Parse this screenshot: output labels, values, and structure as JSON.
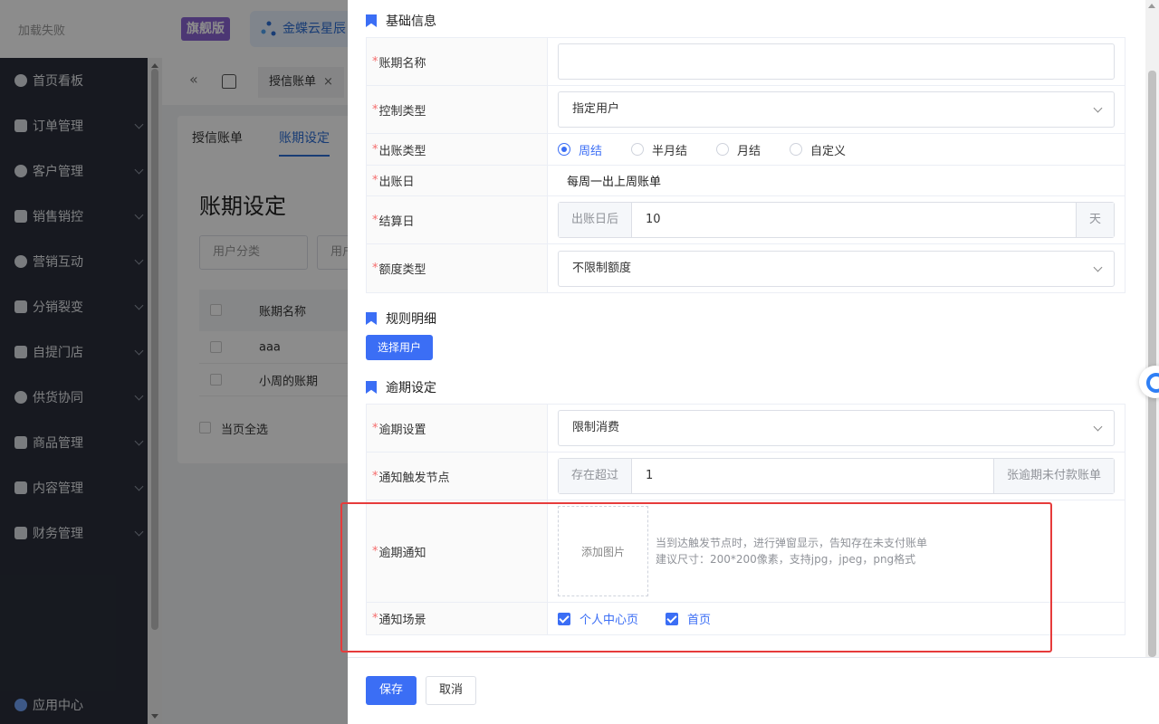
{
  "header": {
    "logo_text": "加载失败",
    "edition_badge": "旗舰版",
    "brand_name": "金蝶云星辰"
  },
  "sidebar": {
    "items": [
      {
        "label": "首页看板",
        "icon": "dashboard-icon"
      },
      {
        "label": "订单管理",
        "icon": "order-icon"
      },
      {
        "label": "客户管理",
        "icon": "customer-icon"
      },
      {
        "label": "销售销控",
        "icon": "tag-icon"
      },
      {
        "label": "营销互动",
        "icon": "marketing-icon"
      },
      {
        "label": "分销裂变",
        "icon": "distribution-icon"
      },
      {
        "label": "自提门店",
        "icon": "store-icon"
      },
      {
        "label": "供货协同",
        "icon": "supply-icon"
      },
      {
        "label": "商品管理",
        "icon": "goods-icon"
      },
      {
        "label": "内容管理",
        "icon": "content-icon"
      },
      {
        "label": "财务管理",
        "icon": "finance-icon"
      }
    ],
    "app_center": "应用中心"
  },
  "tabs": {
    "page_tab": "授信账单",
    "close_glyph": "×",
    "back_glyph": "«"
  },
  "page": {
    "sub_tabs": [
      "授信账单",
      "账期设定"
    ],
    "title": "账期设定",
    "filter1": "用户分类",
    "filter2": "用户",
    "table_header": "账期名称",
    "rows": [
      "aaa",
      "小周的账期"
    ],
    "select_all": "当页全选"
  },
  "drawer": {
    "section_basic": "基础信息",
    "period_name_label": "账期名称",
    "period_name_value": "",
    "control_type_label": "控制类型",
    "control_type_value": "指定用户",
    "bill_type_label": "出账类型",
    "bill_type_options": [
      "周结",
      "半月结",
      "月结",
      "自定义"
    ],
    "bill_type_selected": "周结",
    "bill_day_label": "出账日",
    "bill_day_value": "每周一出上周账单",
    "settle_day_label": "结算日",
    "settle_prefix": "出账日后",
    "settle_value": "10",
    "settle_suffix": "天",
    "credit_type_label": "额度类型",
    "credit_type_value": "不限制额度",
    "section_rules": "规则明细",
    "select_user_button": "选择用户",
    "section_overdue": "逾期设定",
    "overdue_setting_label": "逾期设置",
    "overdue_setting_value": "限制消费",
    "notify_trigger_label": "通知触发节点",
    "notify_trigger_prefix": "存在超过",
    "notify_trigger_value": "1",
    "notify_trigger_suffix": "张逾期未付款账单",
    "overdue_notice_label": "逾期通知",
    "upload_label": "添加图片",
    "notice_hint_line1": "当到达触发节点时，进行弹窗显示，告知存在未支付账单",
    "notice_hint_line2": "建议尺寸：200*200像素，支持jpg，jpeg，png格式",
    "notify_scene_label": "通知场景",
    "notify_scene_options": [
      "个人中心页",
      "首页"
    ],
    "save_button": "保存",
    "cancel_button": "取消",
    "required_mark": "*"
  },
  "colors": {
    "accent": "#3b6ef5",
    "required": "#f56c6c",
    "highlight_box": "#e63b3b",
    "sidebar_bg": "#2a2f3b"
  }
}
